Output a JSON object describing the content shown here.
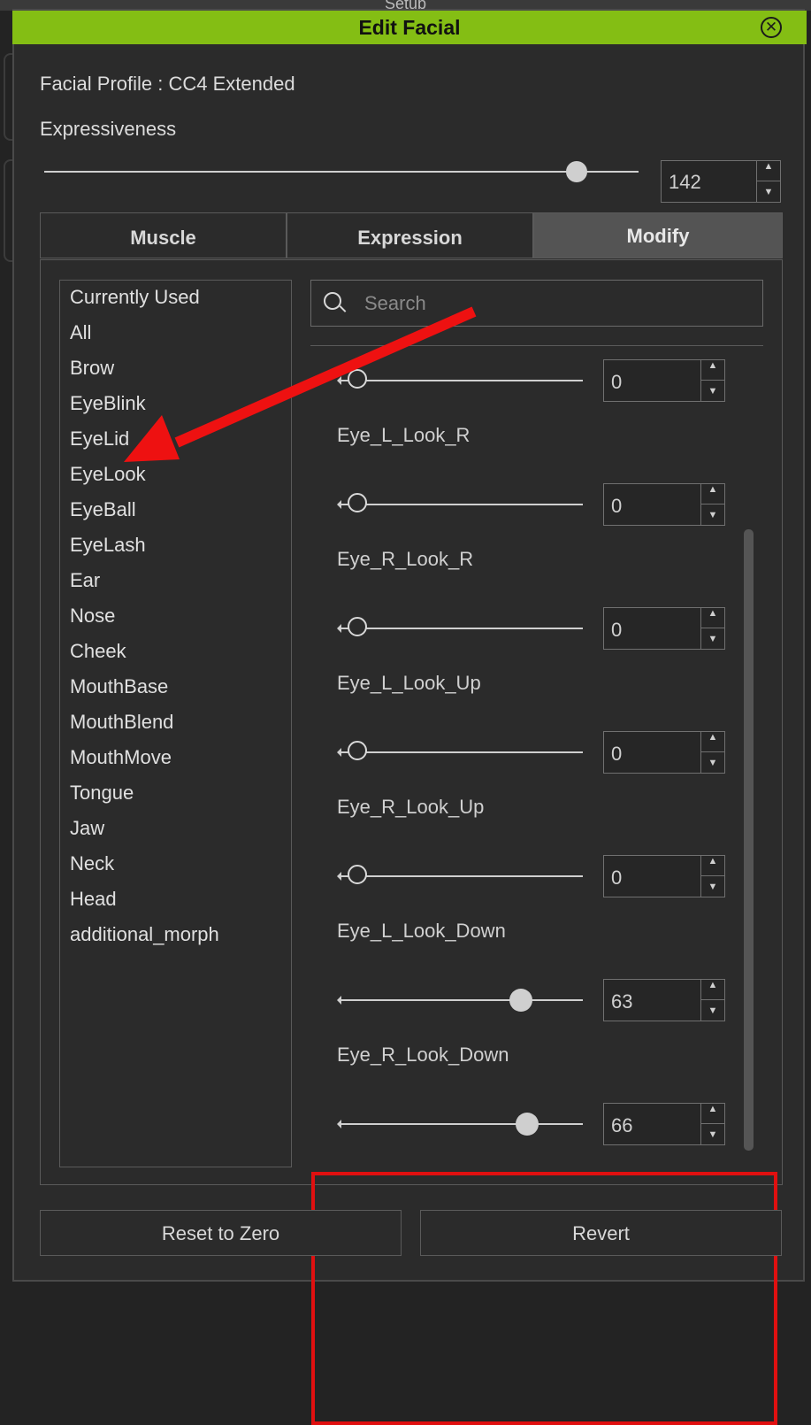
{
  "background_title": "Setup",
  "dialog": {
    "title": "Edit Facial",
    "close_icon": "close-circle-icon",
    "accent": "#84be14"
  },
  "profile_label": "Facial Profile : CC4 Extended",
  "expressiveness": {
    "label": "Expressiveness",
    "value": "142",
    "slider_fraction": 0.93
  },
  "tabs": [
    {
      "label": "Muscle",
      "active": false
    },
    {
      "label": "Expression",
      "active": false
    },
    {
      "label": "Modify",
      "active": true
    }
  ],
  "categories": [
    "Currently Used",
    "All",
    "Brow",
    "EyeBlink",
    "EyeLid",
    "EyeLook",
    "EyeBall",
    "EyeLash",
    "Ear",
    "Nose",
    "Cheek",
    "MouthBase",
    "MouthBlend",
    "MouthMove",
    "Tongue",
    "Jaw",
    "Neck",
    "Head",
    "additional_morph"
  ],
  "search": {
    "placeholder": "Search",
    "icon": "search-icon"
  },
  "morphs": [
    {
      "name": "",
      "value": "0",
      "fraction": 0.0
    },
    {
      "name": "Eye_L_Look_R",
      "value": "0",
      "fraction": 0.0
    },
    {
      "name": "Eye_R_Look_R",
      "value": "0",
      "fraction": 0.0
    },
    {
      "name": "Eye_L_Look_Up",
      "value": "0",
      "fraction": 0.0
    },
    {
      "name": "Eye_R_Look_Up",
      "value": "0",
      "fraction": 0.0
    },
    {
      "name": "Eye_L_Look_Down",
      "value": "63",
      "fraction": 0.63
    },
    {
      "name": "Eye_R_Look_Down",
      "value": "66",
      "fraction": 0.66
    }
  ],
  "annotation_color": "#e01010",
  "buttons": {
    "reset": "Reset to Zero",
    "revert": "Revert"
  }
}
